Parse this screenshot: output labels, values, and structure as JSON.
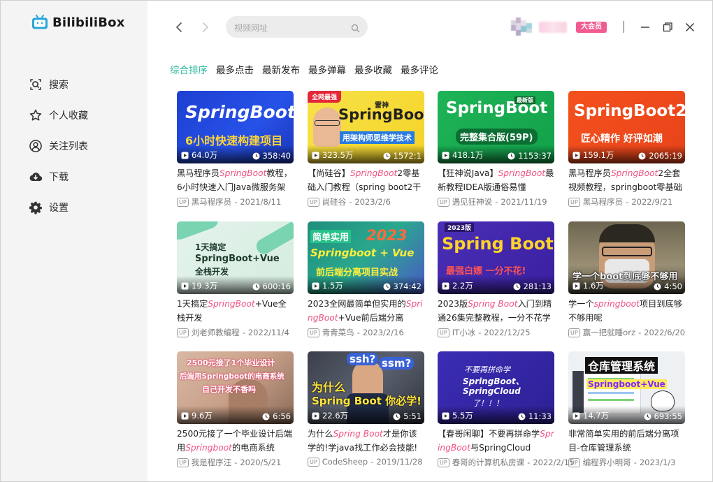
{
  "app": {
    "name": "BilibiliBox"
  },
  "sidebar": {
    "items": [
      {
        "label": "搜索",
        "icon": "search-icon"
      },
      {
        "label": "个人收藏",
        "icon": "star-icon"
      },
      {
        "label": "关注列表",
        "icon": "user-circle-icon"
      },
      {
        "label": "下载",
        "icon": "cloud-download-icon"
      },
      {
        "label": "设置",
        "icon": "gear-icon"
      }
    ]
  },
  "top": {
    "search_placeholder": "视频网址",
    "badge": "大会员"
  },
  "tabs": [
    {
      "label": "综合排序",
      "active": true
    },
    {
      "label": "最多点击",
      "active": false
    },
    {
      "label": "最新发布",
      "active": false
    },
    {
      "label": "最多弹幕",
      "active": false
    },
    {
      "label": "最多收藏",
      "active": false
    },
    {
      "label": "最多评论",
      "active": false
    }
  ],
  "colors": {
    "accent": "#2eb8a0",
    "highlight": "#f0517f",
    "badge": "#f25b8f"
  },
  "videos": [
    {
      "views": "64.0万",
      "duration": "358:40",
      "title_pre": "黑马程序员",
      "title_hl": "SpringBoot",
      "title_post": "教程，6小时快速入门Java微服务架构",
      "up": "黑马程序员",
      "date": "2021/8/11",
      "cover_lines": [
        "SpringBoot",
        "6小时快速构建项目"
      ]
    },
    {
      "views": "323.5万",
      "duration": "1572:1",
      "title_pre": "【尚硅谷】",
      "title_hl": "SpringBoot",
      "title_post": "2零基础入门教程（spring boot2干",
      "up": "尚硅谷",
      "date": "2023/2/6",
      "cover_lines": [
        "全网最强",
        "雷神",
        "SpringBoot2",
        "用架构师思维学技术"
      ]
    },
    {
      "views": "418.1万",
      "duration": "1153:37",
      "title_pre": "【狂神说Java】",
      "title_hl": "SpringBoot",
      "title_post": "最新教程IDEA版通俗易懂",
      "up": "遇见狂神说",
      "date": "2021/11/19",
      "cover_lines": [
        "SpringBoot",
        "最新版",
        "完整集合版(59P)"
      ]
    },
    {
      "views": "159.1万",
      "duration": "2065:19",
      "title_pre": "黑马程序员",
      "title_hl": "SpringBoot",
      "title_post": "2全套视频教程，springboot零基础",
      "up": "黑马程序员",
      "date": "2022/9/21",
      "cover_lines": [
        "SpringBoot2",
        "匠心精作 好评如潮"
      ]
    },
    {
      "views": "19.3万",
      "duration": "600:16",
      "title_pre": "1天搞定",
      "title_hl": "SpringBoot",
      "title_post": "+Vue全栈开发",
      "up": "刘老师教编程",
      "date": "2022/11/4",
      "cover_lines": [
        "1天搞定",
        "SpringBoot+Vue",
        "全栈开发"
      ]
    },
    {
      "views": "1.5万",
      "duration": "374:42",
      "title_pre": "2023全网最简单但实用的",
      "title_hl": "SpringBoot",
      "title_post": "+Vue前后端分离",
      "up": "青青菜鸟",
      "date": "2023/2/16",
      "cover_lines": [
        "简单实用",
        "2023",
        "Springboot + Vue",
        "前后端分离项目实战"
      ]
    },
    {
      "views": "2.2万",
      "duration": "281:13",
      "title_pre": "2023版",
      "title_hl": "Spring Boot",
      "title_post": "入门到精通26集完整教程，一分不花学",
      "up": "IT小冰",
      "date": "2022/12/25",
      "cover_lines": [
        "2023版",
        "Spring Boot",
        "最强白嫖 一分不花!"
      ]
    },
    {
      "views": "1.6万",
      "duration": "4:50",
      "title_pre": "学一个",
      "title_hl": "springboot",
      "title_post": "项目到底够不够用呢",
      "up": "赢一把就睡orz",
      "date": "2022/6/20",
      "cover_lines": [
        "学一个boot到底够不够用"
      ]
    },
    {
      "views": "9.6万",
      "duration": "6:56",
      "title_pre": "2500元接了一个毕业设计后端用",
      "title_hl": "Springboot",
      "title_post": "的电商系统",
      "up": "我是程序汪",
      "date": "2020/5/21",
      "cover_lines": [
        "2500元接了1个毕业设计",
        "后端用Springboot的电商系统",
        "自己开发不香吗"
      ]
    },
    {
      "views": "22.6万",
      "duration": "5:51",
      "title_pre": "为什么",
      "title_hl": "Spring Boot",
      "title_post": "才是你该学的!学java找工作必会技能!在职",
      "up": "CodeSheep",
      "date": "2019/11/28",
      "cover_lines": [
        "ssh?",
        "ssm?",
        "为什么",
        "Spring Boot 你必学!"
      ]
    },
    {
      "views": "5.5万",
      "duration": "11:33",
      "title_pre": "【春哥闲聊】不要再拼命学",
      "title_hl": "SpringBoot",
      "title_post": "与SpringCloud",
      "up": "春哥的计算机私房课",
      "date": "2022/2/15",
      "cover_lines": [
        "不要再拼命学",
        "SpringBoot、",
        "SpringCloud",
        "了！！！"
      ]
    },
    {
      "views": "14.7万",
      "duration": "693:55",
      "title_pre": "非常简单实用的前后端分离项目-仓库管理系统",
      "title_hl": "",
      "title_post": "",
      "up": "编程界小明哥",
      "date": "2023/1/3",
      "cover_lines": [
        "仓库管理系统",
        "Springboot+Vue"
      ]
    }
  ]
}
